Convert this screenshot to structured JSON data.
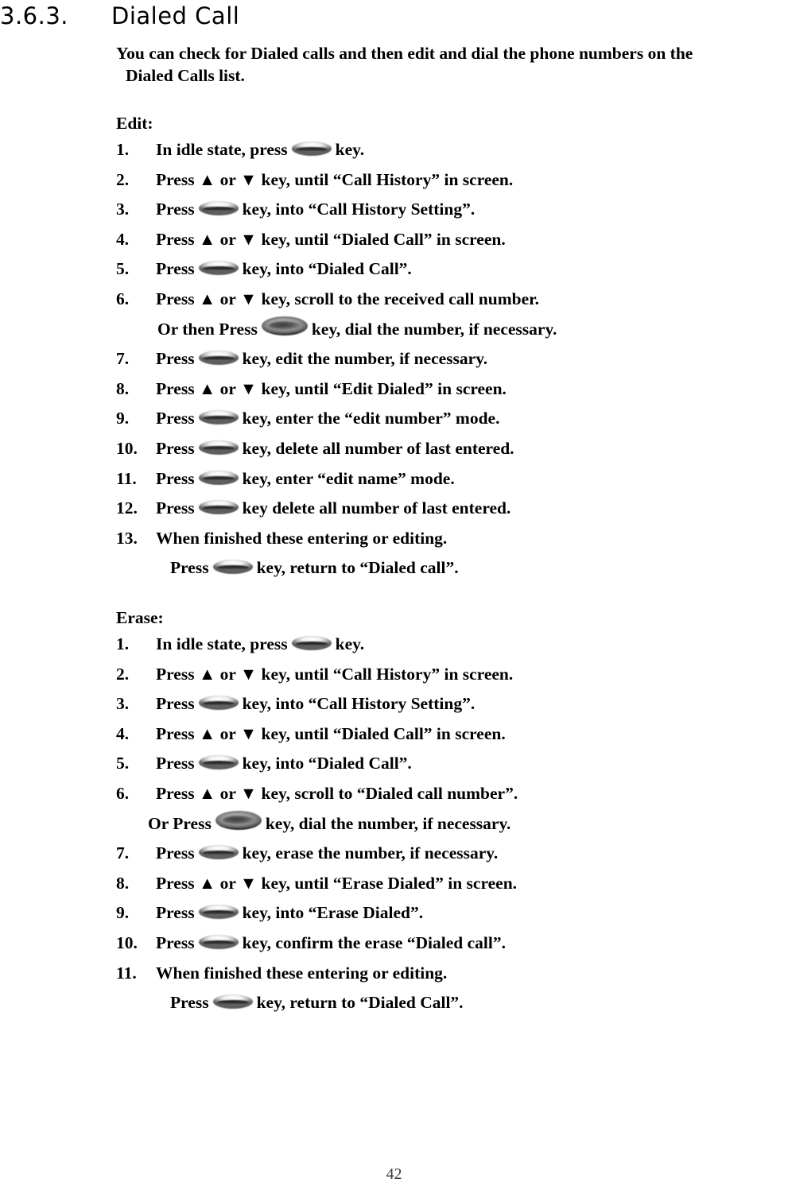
{
  "heading": {
    "number": "3.6.3.",
    "title": "Dialed Call"
  },
  "intro": {
    "line1": "You can check for Dialed calls and then edit and dial the phone numbers on the",
    "line2": "Dialed Calls list."
  },
  "edit_section": {
    "title": "Edit:",
    "steps": [
      {
        "marker": "1.",
        "pre": "In idle state, press",
        "icon": "ok-key-icon",
        "post": "key."
      },
      {
        "marker": "2.",
        "pre": "Press ▲ or ▼ key, until “Call History” in screen.",
        "icon": "",
        "post": ""
      },
      {
        "marker": "3.",
        "pre": "Press",
        "icon": "ok-key-icon",
        "post": "key, into “Call History Setting”."
      },
      {
        "marker": "4.",
        "pre": "Press ▲ or ▼ key, until “Dialed Call” in screen.",
        "icon": "",
        "post": ""
      },
      {
        "marker": "5.",
        "pre": "Press",
        "icon": "ok-key-icon",
        "post": "key, into “Dialed Call”."
      },
      {
        "marker": "6.",
        "pre": "Press ▲ or ▼ key, scroll to the received call number.",
        "icon": "",
        "post": ""
      },
      {
        "marker": "",
        "pre": "Or then Press",
        "icon": "dial-key-icon",
        "post": "key, dial the number, if necessary.",
        "sub": true
      },
      {
        "marker": "7.",
        "pre": "Press",
        "icon": "ok-key-icon",
        "post": "key, edit the number, if necessary."
      },
      {
        "marker": "8.",
        "pre": "Press ▲ or ▼ key, until “Edit Dialed” in screen.",
        "icon": "",
        "post": ""
      },
      {
        "marker": "9.",
        "pre": "Press",
        "icon": "ok-key-icon",
        "post": "key, enter the “edit number” mode."
      },
      {
        "marker": "10.",
        "pre": "Press",
        "icon": "ok-key-icon",
        "post": "key, delete all number of last entered."
      },
      {
        "marker": "11.",
        "pre": "Press",
        "icon": "ok-key-icon",
        "post": "key, enter “edit name” mode."
      },
      {
        "marker": "12.",
        "pre": "Press",
        "icon": "ok-key-icon",
        "post": "key delete all number of last entered."
      },
      {
        "marker": "13.",
        "pre": "When finished these entering or editing.",
        "icon": "",
        "post": ""
      },
      {
        "marker": "",
        "pre": "Press",
        "icon": "ok-key-icon",
        "post": "key, return to “Dialed call”.",
        "sub": true
      }
    ]
  },
  "erase_section": {
    "title": "Erase:",
    "steps": [
      {
        "marker": "1.",
        "pre": "In idle state, press",
        "icon": "ok-key-icon",
        "post": "key."
      },
      {
        "marker": "2.",
        "pre": "Press ▲ or ▼ key, until “Call History” in screen.",
        "icon": "",
        "post": ""
      },
      {
        "marker": "3.",
        "pre": "Press",
        "icon": "ok-key-icon",
        "post": "key, into “Call History Setting”."
      },
      {
        "marker": "4.",
        "pre": "Press ▲ or ▼ key, until “Dialed Call” in screen.",
        "icon": "",
        "post": ""
      },
      {
        "marker": "5.",
        "pre": "Press",
        "icon": "ok-key-icon",
        "post": "key, into “Dialed Call”."
      },
      {
        "marker": "6.",
        "pre": "Press ▲ or ▼ key, scroll to “Dialed call number”.",
        "icon": "",
        "post": ""
      },
      {
        "marker": "",
        "pre": "Or Press",
        "icon": "dial-key-icon",
        "post": "key, dial the number, if necessary.",
        "sub": true
      },
      {
        "marker": "7.",
        "pre": "Press",
        "icon": "ok-key-icon",
        "post": "key, erase the number, if necessary."
      },
      {
        "marker": "8.",
        "pre": "Press ▲ or ▼ key, until “Erase Dialed” in screen.",
        "icon": "",
        "post": ""
      },
      {
        "marker": "9.",
        "pre": "Press",
        "icon": "ok-key-icon",
        "post": "key, into “Erase Dialed”."
      },
      {
        "marker": "10.",
        "pre": "Press",
        "icon": "ok-key-icon",
        "post": "key, confirm the erase “Dialed call”."
      },
      {
        "marker": "11.",
        "pre": "When finished these entering or editing.",
        "icon": "",
        "post": ""
      },
      {
        "marker": "",
        "pre": "Press",
        "icon": "ok-key-icon",
        "post": "key, return to “Dialed Call”.",
        "sub": true
      }
    ]
  },
  "footer": {
    "page_number": "42"
  }
}
